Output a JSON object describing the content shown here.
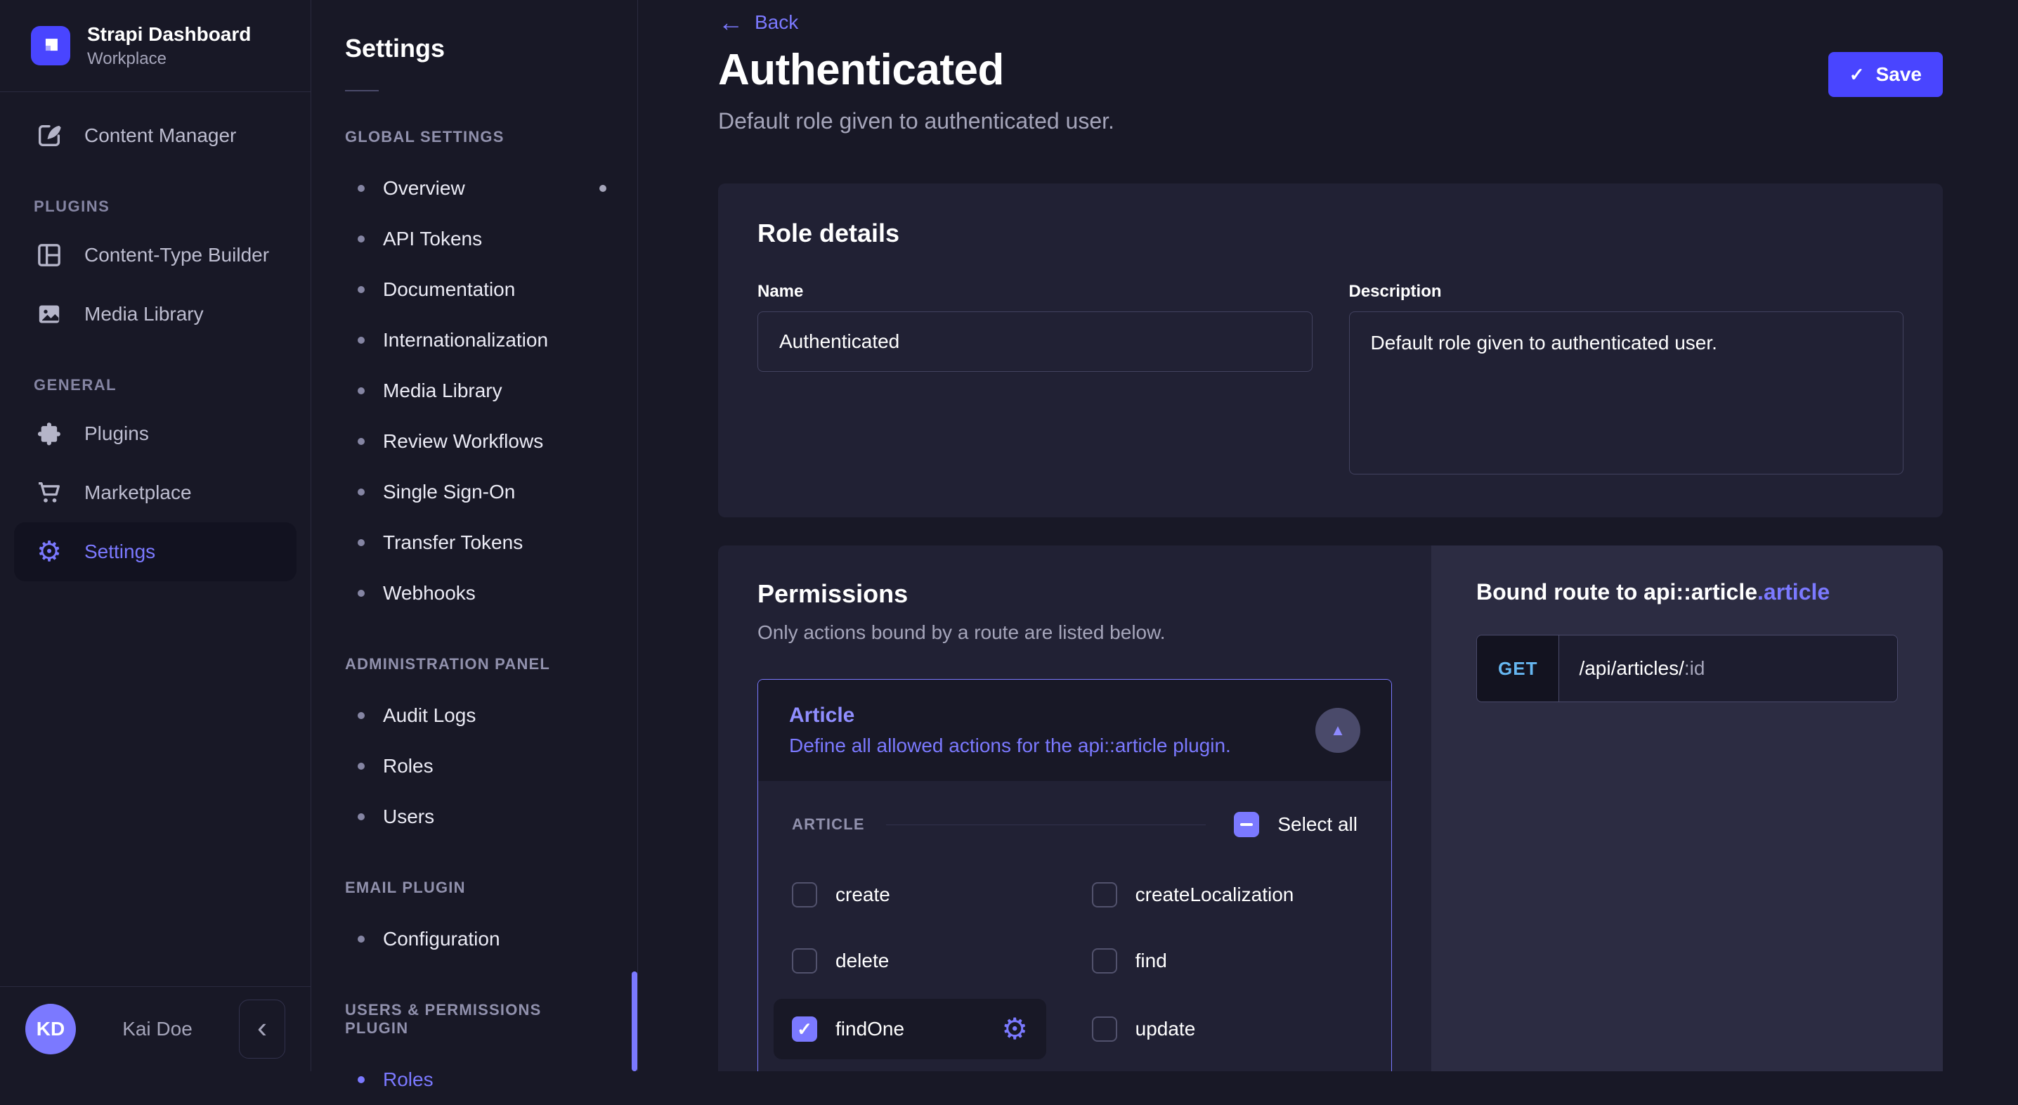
{
  "colors": {
    "primary": "#4945ff",
    "accent": "#7b79ff",
    "method_get": "#66b7f1",
    "surface": "#212134",
    "background": "#181826"
  },
  "icons": {
    "check": "✓",
    "back_arrow": "←",
    "collapse": "‹",
    "triangle_up": "▲",
    "gear": "⚙",
    "bullet": "•"
  },
  "sidebar": {
    "brand": {
      "title": "Strapi Dashboard",
      "subtitle": "Workplace"
    },
    "primary_items": [
      {
        "label": "Content Manager",
        "icon": "pen-icon",
        "active": false
      }
    ],
    "sections": [
      {
        "label": "PLUGINS",
        "items": [
          {
            "label": "Content-Type Builder",
            "icon": "layout-icon",
            "active": false
          },
          {
            "label": "Media Library",
            "icon": "image-icon",
            "active": false
          }
        ]
      },
      {
        "label": "GENERAL",
        "items": [
          {
            "label": "Plugins",
            "icon": "puzzle-icon",
            "active": false
          },
          {
            "label": "Marketplace",
            "icon": "cart-icon",
            "active": false
          },
          {
            "label": "Settings",
            "icon": "gear-icon",
            "active": true
          }
        ]
      }
    ],
    "footer": {
      "avatar_initials": "KD",
      "user_name": "Kai Doe"
    }
  },
  "subnav": {
    "title": "Settings",
    "sections": [
      {
        "label": "GLOBAL SETTINGS",
        "items": [
          {
            "label": "Overview",
            "active": false,
            "notification_dot": true
          },
          {
            "label": "API Tokens",
            "active": false
          },
          {
            "label": "Documentation",
            "active": false
          },
          {
            "label": "Internationalization",
            "active": false
          },
          {
            "label": "Media Library",
            "active": false
          },
          {
            "label": "Review Workflows",
            "active": false
          },
          {
            "label": "Single Sign-On",
            "active": false
          },
          {
            "label": "Transfer Tokens",
            "active": false
          },
          {
            "label": "Webhooks",
            "active": false
          }
        ]
      },
      {
        "label": "ADMINISTRATION PANEL",
        "items": [
          {
            "label": "Audit Logs",
            "active": false
          },
          {
            "label": "Roles",
            "active": false
          },
          {
            "label": "Users",
            "active": false
          }
        ]
      },
      {
        "label": "EMAIL PLUGIN",
        "items": [
          {
            "label": "Configuration",
            "active": false
          }
        ]
      },
      {
        "label": "USERS & PERMISSIONS PLUGIN",
        "items": [
          {
            "label": "Roles",
            "active": true
          }
        ]
      }
    ]
  },
  "header": {
    "back_label": "Back",
    "title": "Authenticated",
    "subtitle": "Default role given to authenticated user.",
    "save_label": "Save"
  },
  "role_details": {
    "heading": "Role details",
    "name_label": "Name",
    "name_value": "Authenticated",
    "description_label": "Description",
    "description_value": "Default role given to authenticated user."
  },
  "permissions": {
    "heading": "Permissions",
    "subtitle": "Only actions bound by a route are listed below.",
    "accordion": {
      "title": "Article",
      "description": "Define all allowed actions for the api::article plugin.",
      "expanded": true
    },
    "group_label": "ARTICLE",
    "select_all_label": "Select all",
    "select_all_state": "indeterminate",
    "actions": [
      {
        "label": "create",
        "checked": false,
        "selected": false,
        "has_settings": false
      },
      {
        "label": "createLocalization",
        "checked": false,
        "selected": false,
        "has_settings": false
      },
      {
        "label": "delete",
        "checked": false,
        "selected": false,
        "has_settings": false
      },
      {
        "label": "find",
        "checked": false,
        "selected": false,
        "has_settings": false
      },
      {
        "label": "findOne",
        "checked": true,
        "selected": true,
        "has_settings": true
      },
      {
        "label": "update",
        "checked": false,
        "selected": false,
        "has_settings": false
      }
    ]
  },
  "bound_route": {
    "title_white": "Bound route to api::article",
    "title_accent": ".article",
    "method": "GET",
    "path": "/api/articles/",
    "param": ":id"
  }
}
